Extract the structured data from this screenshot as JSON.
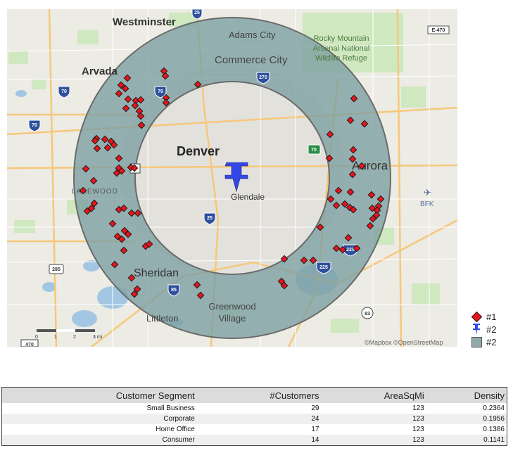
{
  "map": {
    "labels": {
      "westminster": "Westminster",
      "adams_city": "Adams City",
      "commerce_city": "Commerce City",
      "rocky_mountain_line1": "Rocky Mountain",
      "rocky_mountain_line2": "Arsenal National",
      "rocky_mountain_line3": "Wildlife Refuge",
      "arvada": "Arvada",
      "denver": "Denver",
      "aurora": "Aurora",
      "glendale": "Glendale",
      "lakewood": "LAKEWOOD",
      "bfk": "BFK",
      "sheridan": "Sheridan",
      "greenwood_line1": "Greenwood",
      "greenwood_line2": "Village",
      "littleton": "Littleton",
      "attribution": "©Mapbox ©OpenStreetMap"
    },
    "shields": {
      "i25_top": "25",
      "e470": "E-470",
      "i70_a": "70",
      "i70_b": "70",
      "i70_c": "70",
      "i270": "270",
      "i76": "70",
      "us6": "6",
      "i25_mid": "25",
      "i225_a": "225",
      "i225_b": "225",
      "i85": "85",
      "i285": "285",
      "i83": "83",
      "i470": "470"
    },
    "scale": {
      "ticks": [
        "0",
        "1",
        "2",
        "3 mi"
      ]
    },
    "colors": {
      "ring": "#7b9da1",
      "marker": "#e8141b",
      "pin": "#3346e6",
      "park": "#cfe8c0",
      "water": "#a3c7e3"
    }
  },
  "legend": [
    {
      "symbol": "diamond",
      "label": "#1"
    },
    {
      "symbol": "pin",
      "label": "#2"
    },
    {
      "symbol": "square",
      "label": "#2"
    }
  ],
  "table": {
    "headers": [
      "Customer Segment",
      "#Customers",
      "AreaSqMi",
      "Density"
    ],
    "rows": [
      [
        "Small Business",
        "29",
        "123",
        "0.2364"
      ],
      [
        "Corporate",
        "24",
        "123",
        "0.1956"
      ],
      [
        "Home Office",
        "17",
        "123",
        "0.1386"
      ],
      [
        "Consumer",
        "14",
        "123",
        "0.1141"
      ]
    ]
  }
}
